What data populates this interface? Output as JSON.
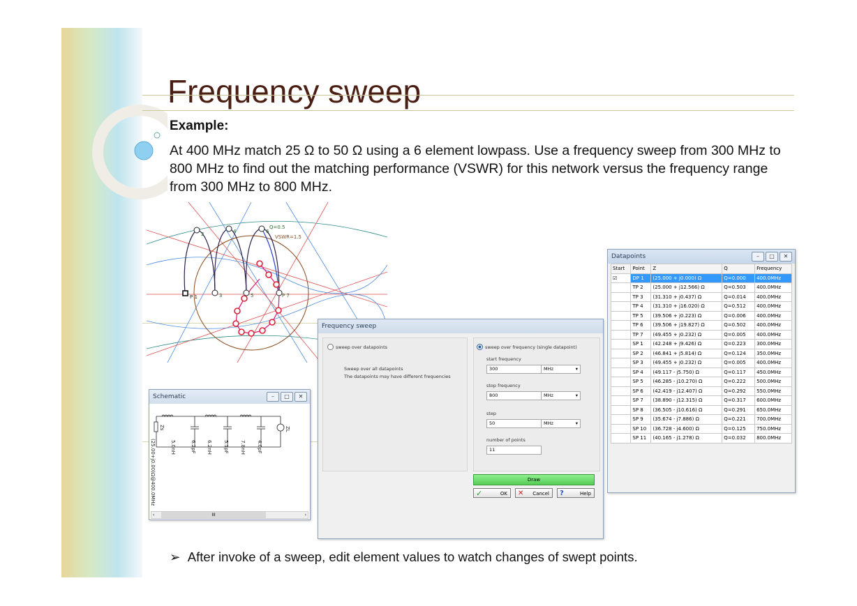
{
  "slide": {
    "title": "Frequency sweep",
    "example_label": "Example:",
    "body": "At 400 MHz match 25 Ω to 50 Ω using a 6 element lowpass.  Use a frequency sweep from 300 MHz to 800 MHz to find out the matching performance (VSWR) for this network versus the frequency range from 300 MHz to 800 MHz.",
    "bullet": "After invoke of a sweep, edit element values to watch changes of swept points."
  },
  "smith": {
    "labels": {
      "tp2": "2",
      "tp4": "4",
      "tp6": "6",
      "tp1": "P 1",
      "tp3": "3",
      "tp5": "5",
      "tp7": "P 7",
      "q": "Q=0.5",
      "vswr": "VSWR=1.5"
    }
  },
  "datapoints": {
    "title": "Datapoints",
    "columns": [
      "Start",
      "Point",
      "Z",
      "Q",
      "Frequency"
    ],
    "rows": [
      {
        "start": "☑",
        "point": "DP 1",
        "z": "(25.000 + j0.000) Ω",
        "q": "Q=0.000",
        "f": "400.0MHz"
      },
      {
        "start": "",
        "point": "TP 2",
        "z": "(25.000 + j12.566) Ω",
        "q": "Q=0.503",
        "f": "400.0MHz"
      },
      {
        "start": "",
        "point": "TP 3",
        "z": "(31.310 + j0.437) Ω",
        "q": "Q=0.014",
        "f": "400.0MHz"
      },
      {
        "start": "",
        "point": "TP 4",
        "z": "(31.310 + j16.020) Ω",
        "q": "Q=0.512",
        "f": "400.0MHz"
      },
      {
        "start": "",
        "point": "TP 5",
        "z": "(39.506 + j0.223) Ω",
        "q": "Q=0.006",
        "f": "400.0MHz"
      },
      {
        "start": "",
        "point": "TP 6",
        "z": "(39.506 + j19.827) Ω",
        "q": "Q=0.502",
        "f": "400.0MHz"
      },
      {
        "start": "",
        "point": "TP 7",
        "z": "(49.455 + j0.232) Ω",
        "q": "Q=0.005",
        "f": "400.0MHz"
      },
      {
        "start": "",
        "point": "SP 1",
        "z": "(42.248 + j9.426) Ω",
        "q": "Q=0.223",
        "f": "300.0MHz"
      },
      {
        "start": "",
        "point": "SP 2",
        "z": "(46.841 + j5.814) Ω",
        "q": "Q=0.124",
        "f": "350.0MHz"
      },
      {
        "start": "",
        "point": "SP 3",
        "z": "(49.455 + j0.232) Ω",
        "q": "Q=0.005",
        "f": "400.0MHz"
      },
      {
        "start": "",
        "point": "SP 4",
        "z": "(49.117 - j5.750) Ω",
        "q": "Q=0.117",
        "f": "450.0MHz"
      },
      {
        "start": "",
        "point": "SP 5",
        "z": "(46.285 - j10.270) Ω",
        "q": "Q=0.222",
        "f": "500.0MHz"
      },
      {
        "start": "",
        "point": "SP 6",
        "z": "(42.419 - j12.407) Ω",
        "q": "Q=0.292",
        "f": "550.0MHz"
      },
      {
        "start": "",
        "point": "SP 7",
        "z": "(38.890 - j12.315) Ω",
        "q": "Q=0.317",
        "f": "600.0MHz"
      },
      {
        "start": "",
        "point": "SP 8",
        "z": "(36.505 - j10.616) Ω",
        "q": "Q=0.291",
        "f": "650.0MHz"
      },
      {
        "start": "",
        "point": "SP 9",
        "z": "(35.674 - j7.886) Ω",
        "q": "Q=0.221",
        "f": "700.0MHz"
      },
      {
        "start": "",
        "point": "SP 10",
        "z": "(36.728 - j4.600) Ω",
        "q": "Q=0.125",
        "f": "750.0MHz"
      },
      {
        "start": "",
        "point": "SP 11",
        "z": "(40.165 - j1.278) Ω",
        "q": "Q=0.032",
        "f": "800.0MHz"
      }
    ]
  },
  "sweep": {
    "title": "Frequency sweep",
    "opt_datapoints": "sweep over datapoints",
    "desc1": "Sweep over all datapoints",
    "desc2": "The datapoints may have different frequencies",
    "opt_frequency": "sweep over frequency (single datapoint)",
    "start_label": "start frequency",
    "start_value": "300",
    "stop_label": "stop frequency",
    "stop_value": "800",
    "step_label": "step",
    "step_value": "50",
    "unit": "MHz",
    "points_label": "number of points",
    "points_value": "11",
    "draw": "Draw",
    "ok": "OK",
    "cancel": "Cancel",
    "help": "Help"
  },
  "schematic": {
    "title": "Schematic",
    "source_label": "Zs",
    "load_label": "ZL",
    "values": [
      "5.0nH",
      "6.2pF",
      "6.2nH",
      "5.1pF",
      "7.8nH",
      "4.0pF"
    ],
    "impedance_label": "(25.00+j0.00)Ω@400.0MHz",
    "scroll_mark": "III"
  },
  "colors": {
    "title": "#4a1e12",
    "selection": "#3399ff",
    "draw_button": "#6fe06f"
  }
}
